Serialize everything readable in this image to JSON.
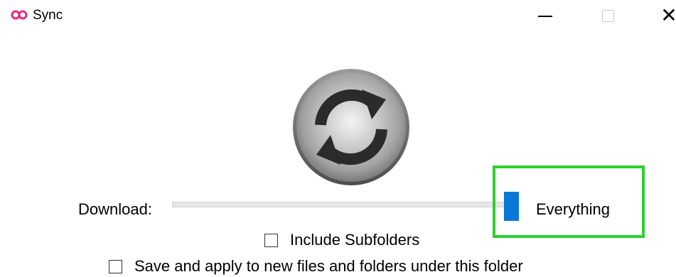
{
  "window": {
    "title": "Sync",
    "icon": "infinity-icon",
    "accent_color": "#e8287e",
    "controls": {
      "minimize": "minimize-icon",
      "maximize": "maximize-icon",
      "close": "close-icon",
      "close_glyph": "✕"
    }
  },
  "main": {
    "logo": "sync-arrows-icon",
    "download": {
      "label": "Download:",
      "slider_value": "Everything",
      "slider_level": 1.0,
      "thumb_color": "#0a78d7"
    },
    "highlight_color": "#2bd12b",
    "options": [
      {
        "label": "Include Subfolders",
        "checked": false
      },
      {
        "label": "Save and apply to new files and folders under this folder",
        "checked": false
      }
    ]
  }
}
